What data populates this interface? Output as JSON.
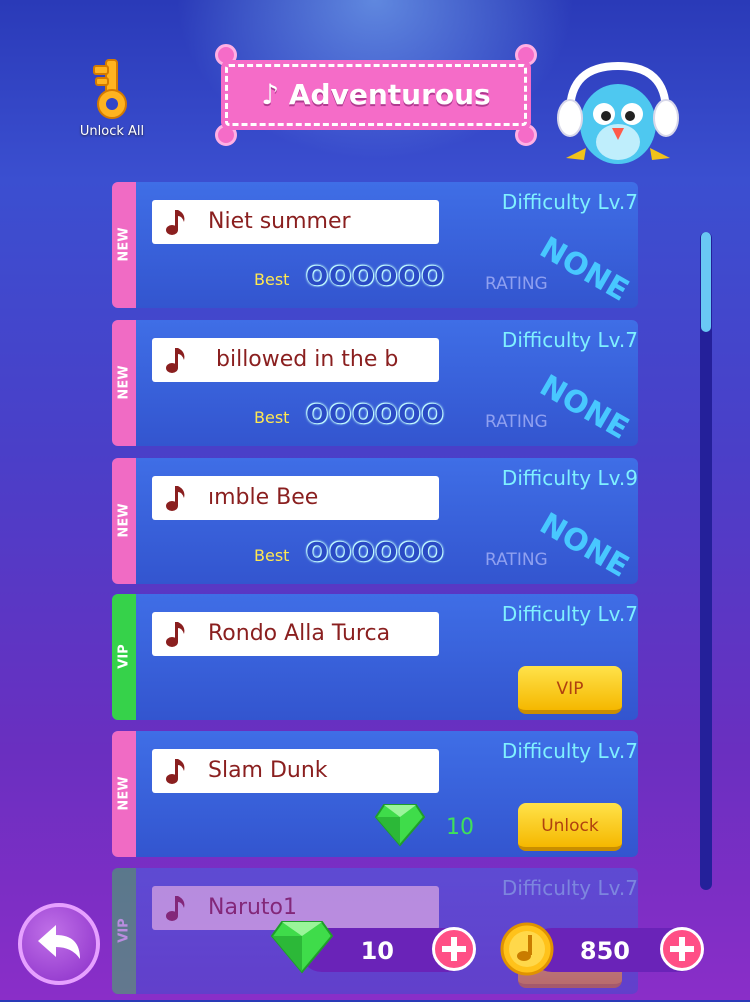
{
  "header": {
    "unlock_all_label": "Unlock All",
    "title": "Adventurous",
    "title_note_icon": "music-note-icon",
    "mascot": "bird-headphones-mascot"
  },
  "songs": [
    {
      "tag": "NEW",
      "name": "Niet summer",
      "difficulty": "Difficulty Lv.7",
      "best_label": "Best",
      "best": "OOOOOO",
      "rating_label": "RATING",
      "rating": "NONE"
    },
    {
      "tag": "NEW",
      "name": "billowed in the b",
      "difficulty": "Difficulty Lv.7",
      "best_label": "Best",
      "best": "OOOOOO",
      "rating_label": "RATING",
      "rating": "NONE"
    },
    {
      "tag": "NEW",
      "name": "ımble Bee",
      "difficulty": "Difficulty Lv.9",
      "best_label": "Best",
      "best": "OOOOOO",
      "rating_label": "RATING",
      "rating": "NONE"
    },
    {
      "tag": "VIP",
      "name": "Rondo Alla Turca",
      "difficulty": "Difficulty Lv.7",
      "button": "VIP"
    },
    {
      "tag": "NEW",
      "name": "Slam Dunk",
      "difficulty": "Difficulty Lv.7",
      "gem_cost": "10",
      "button": "Unlock"
    },
    {
      "tag": "VIP",
      "name": "Naruto1",
      "difficulty": "Difficulty Lv.7",
      "button": "VIP"
    }
  ],
  "footer": {
    "gems": "10",
    "coins": "850"
  },
  "colors": {
    "new_tag": "#f06bc4",
    "vip_tag": "#36d24a",
    "card": "#3f6ee6",
    "difficulty_text": "#7ff0ff",
    "button_yellow": "#ffe24a",
    "plus_button": "#ff4f86"
  }
}
